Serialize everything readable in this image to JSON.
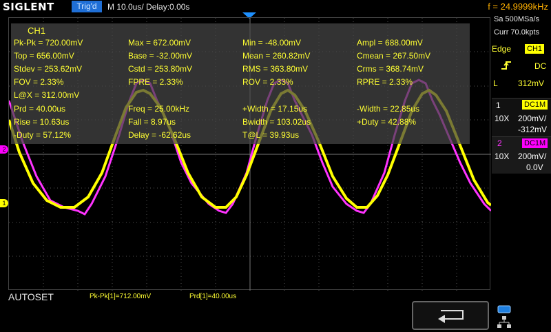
{
  "header": {
    "logo": "SIGLENT",
    "trigger_state": "Trig'd",
    "timebase": "M 10.0us/",
    "delay": "Delay:0.00s",
    "frequency": "f = 24.9999kHz"
  },
  "acquisition": {
    "sample_rate": "Sa 500MSa/s",
    "memory": "Curr 70.0kpts"
  },
  "trigger": {
    "type": "Edge",
    "source": "CH1",
    "slope_icon": "rising-edge-icon",
    "coupling": "DC",
    "level_label": "L",
    "level_value": "312mV"
  },
  "channels": [
    {
      "num": "1",
      "coupling": "DC1M",
      "probe": "10X",
      "scale": "200mV/",
      "offset": "-312mV",
      "color": "#ffff00"
    },
    {
      "num": "2",
      "coupling": "DC1M",
      "probe": "10X",
      "scale": "200mV/",
      "offset": "0.0V",
      "color": "#ff00ff"
    }
  ],
  "measurements_panel": {
    "title": "CH1",
    "items": [
      "Pk-Pk = 720.00mV",
      "Max = 672.00mV",
      "Min = -48.00mV",
      "Ampl = 688.00mV",
      "Top = 656.00mV",
      "Base = -32.00mV",
      "Mean = 260.82mV",
      "Cmean = 267.50mV",
      "Stdev = 253.62mV",
      "Cstd = 253.80mV",
      "RMS = 363.80mV",
      "Crms = 368.74mV",
      "FOV = 2.33%",
      "FPRE = 2.33%",
      "ROV = 2.33%",
      "RPRE = 2.33%",
      "L@X = 312.00mV",
      "Prd = 40.00us",
      "Freq = 25.00kHz",
      "+Width = 17.15us",
      "-Width = 22.85us",
      "Rise = 10.63us",
      "Fall = 8.97us",
      "Bwidth = 103.02us",
      "+Duty = 42.88%",
      "-Duty = 57.12%",
      "Delay = -62.62us",
      "T@L = 39.93us"
    ]
  },
  "channel_markers": {
    "ch1": "1",
    "ch2": "2"
  },
  "footer": {
    "autoset": "AUTOSET",
    "meas_1": "Pk-Pk[1]=712.00mV",
    "meas_2": "Prd[1]=40.00us"
  },
  "icons": {
    "trigger_position": "trigger-position-icon",
    "back": "return-arrow-icon",
    "usb": "usb-icon",
    "network": "network-icon"
  }
}
